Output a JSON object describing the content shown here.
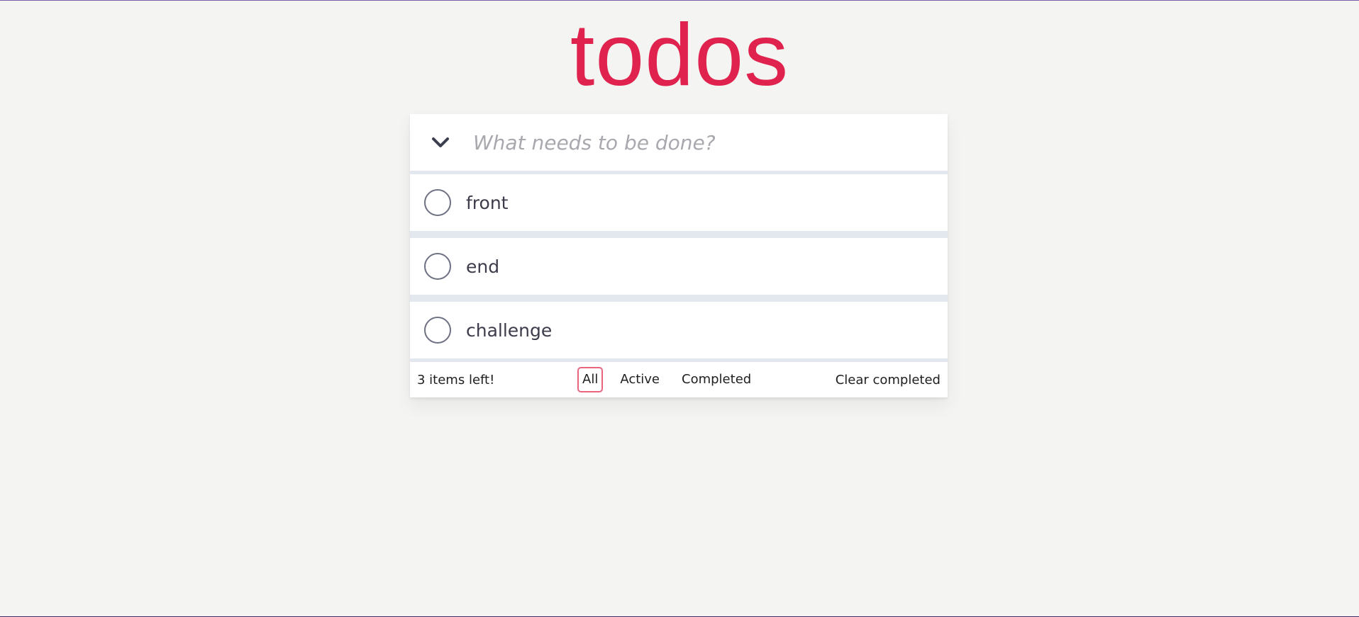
{
  "app": {
    "title": "todos"
  },
  "new_todo": {
    "placeholder": "What needs to be done?",
    "value": "",
    "toggle_all_icon": "chevron-down-icon"
  },
  "todos": [
    {
      "label": "front",
      "completed": false
    },
    {
      "label": "end",
      "completed": false
    },
    {
      "label": "challenge",
      "completed": false
    }
  ],
  "footer": {
    "count_label": "3 items left!",
    "filters": [
      {
        "label": "All",
        "selected": true
      },
      {
        "label": "Active",
        "selected": false
      },
      {
        "label": "Completed",
        "selected": false
      }
    ],
    "clear_label": "Clear completed"
  },
  "colors": {
    "title": "#e0234e",
    "selected_filter_border": "#e9667e",
    "background": "#f4f4f3",
    "separator": "#e3e8ef"
  }
}
